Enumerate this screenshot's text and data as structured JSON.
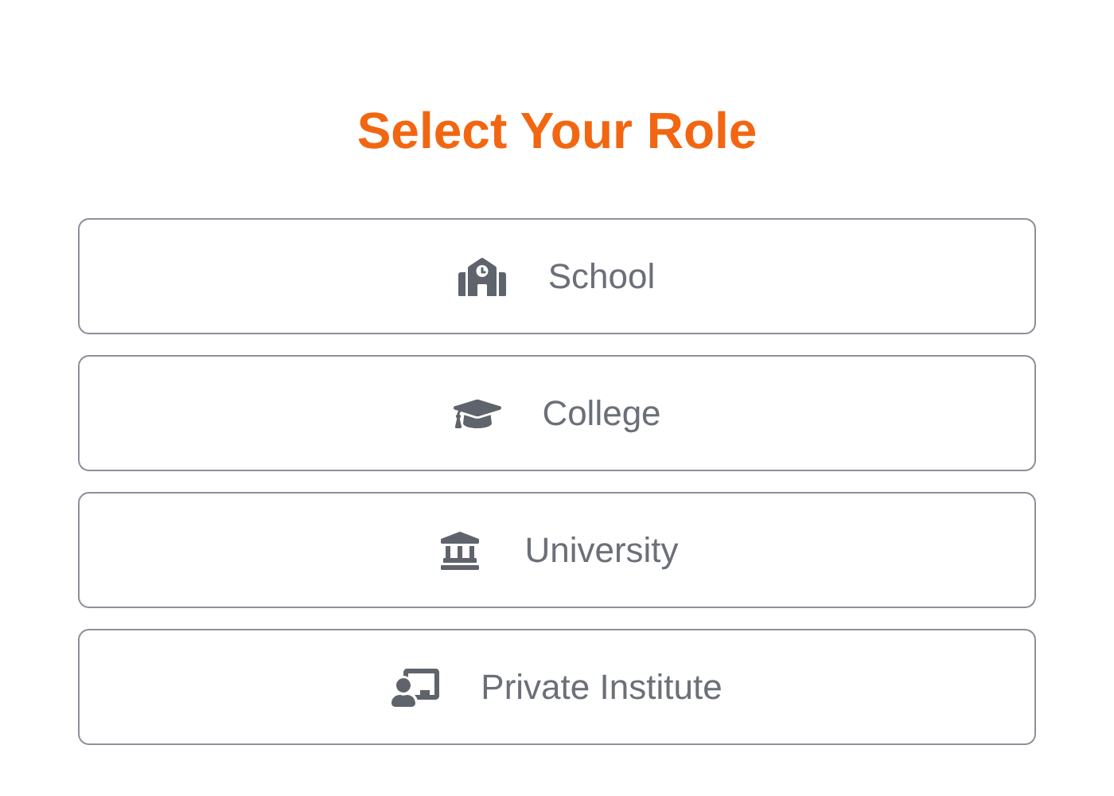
{
  "title": "Select Your Role",
  "roles": [
    {
      "kind": "school",
      "label": "School"
    },
    {
      "kind": "college",
      "label": "College"
    },
    {
      "kind": "university",
      "label": "University"
    },
    {
      "kind": "private",
      "label": "Private Institute"
    }
  ]
}
